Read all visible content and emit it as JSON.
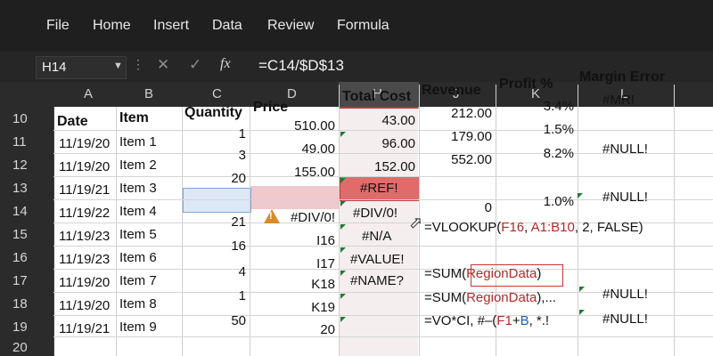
{
  "ribbon": {
    "tabs": [
      "File",
      "Home",
      "Insert",
      "Data",
      "Review",
      "Formula"
    ]
  },
  "formula_bar": {
    "name_box": "H14",
    "fx_label": "fx",
    "formula": "=C14/$D$13"
  },
  "columns": [
    "A",
    "B",
    "C",
    "D",
    "H",
    "J",
    "K",
    "L"
  ],
  "rows": [
    "10",
    "11",
    "12",
    "13",
    "14",
    "15",
    "16",
    "17",
    "18",
    "19",
    "20"
  ],
  "headers": {
    "date": "Date",
    "item": "Item",
    "quantity": "Quantity",
    "price": "Price",
    "total_cost": "Total Cost",
    "revenue": "Revenue",
    "profit": "Profit %",
    "margin_error": "Margin Error"
  },
  "dates": [
    "11/19/20",
    "11/19/20",
    "11/19/21",
    "11/19/22",
    "11/19/23",
    "11/19/23",
    "11/19/20",
    "11/19/20",
    "11/19/21"
  ],
  "items": [
    "Item 1",
    "Item 2",
    "Item 3",
    "Item 4",
    "Item 5",
    "Item 6",
    "Item 7",
    "Item 8",
    "Item 9"
  ],
  "quantity": [
    "1",
    "3",
    "20",
    "21",
    "16",
    "4",
    "1",
    "50"
  ],
  "price": [
    "510.00",
    "49.00",
    "155.00",
    "#DIV/0!",
    "I16",
    "I17",
    "K18",
    "K19",
    "20"
  ],
  "total_cost": [
    "43.00",
    "96.00",
    "152.00",
    "#REF!",
    "#DIV/0!",
    "#N/A",
    "#VALUE!",
    "#NAME?"
  ],
  "revenue": [
    "212.00",
    "179.00",
    "552.00",
    "0"
  ],
  "profit": [
    "3.4%",
    "1.5%",
    "8.2%",
    "1.0%"
  ],
  "margin_error": [
    "#MR!",
    "#NULL!",
    "#NULL!",
    "#NULL!",
    "#NULL!"
  ],
  "formulas": {
    "row15_a": "=VLOOKUP(",
    "row15_b": "F16",
    "row15_c": ", ",
    "row15_d": "A1:B10",
    "row15_e": ", 2, FALSE)",
    "row17_a": "=SUM(",
    "row17_b": "RegionData",
    "row17_c": ")",
    "row18_a": "=SUM(",
    "row18_b": "RegionData",
    "row18_c": "),...",
    "row19_a": "=VO*CI, #–(",
    "row19_b": "F1",
    "row19_c": "+",
    "row19_d": "B",
    "row19_e": ", *.!"
  },
  "colors": {
    "ribbon": "#1f1f1f",
    "error_red": "#e06b6b",
    "ref_blue": "#1a5fb4",
    "ref_red": "#b02a2a",
    "warning": "#d98b2b"
  }
}
